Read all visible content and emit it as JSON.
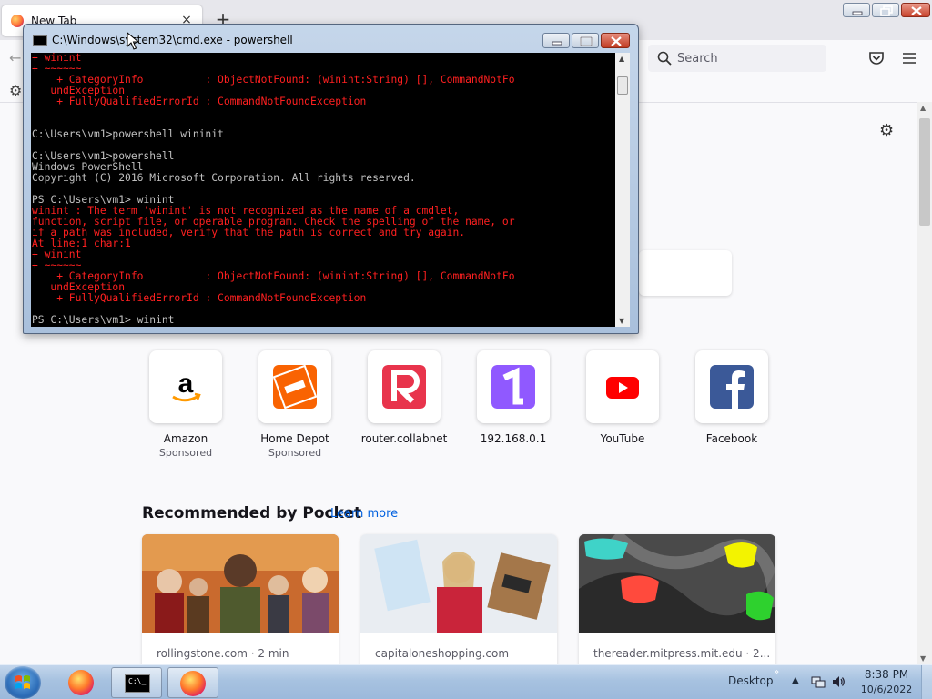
{
  "firefox": {
    "tab_title": "New Tab",
    "tab_close": "×",
    "new_tab": "+",
    "search_placeholder": "Search",
    "top_sites": [
      {
        "name": "Amazon",
        "sub": "Sponsored",
        "icon": "amazon-logo"
      },
      {
        "name": "Home Depot",
        "sub": "Sponsored",
        "icon": "home-depot-logo"
      },
      {
        "name": "router.collabnet",
        "sub": "",
        "icon": "router-logo"
      },
      {
        "name": "192.168.0.1",
        "sub": "",
        "icon": "number-one-logo"
      },
      {
        "name": "YouTube",
        "sub": "",
        "icon": "youtube-logo"
      },
      {
        "name": "Facebook",
        "sub": "",
        "icon": "facebook-logo"
      }
    ],
    "pocket": {
      "title": "Recommended by Pocket",
      "learn_more": "Learn more",
      "stories": [
        {
          "source": "rollingstone.com · 2 min"
        },
        {
          "source": "capitaloneshopping.com"
        },
        {
          "source": "thereader.mitpress.mit.edu · 2..."
        }
      ]
    }
  },
  "cmd": {
    "title": "C:\\Windows\\system32\\cmd.exe - powershell",
    "lines": [
      {
        "t": "+ winint",
        "err": true
      },
      {
        "t": "+ ~~~~~~",
        "err": true
      },
      {
        "t": "    + CategoryInfo          : ObjectNotFound: (winint:String) [], CommandNotFo",
        "err": true
      },
      {
        "t": "   undException",
        "err": true
      },
      {
        "t": "    + FullyQualifiedErrorId : CommandNotFoundException",
        "err": true
      },
      {
        "t": "",
        "err": false
      },
      {
        "t": "",
        "err": false
      },
      {
        "t": "C:\\Users\\vm1>powershell wininit",
        "err": false
      },
      {
        "t": "",
        "err": false
      },
      {
        "t": "C:\\Users\\vm1>powershell",
        "err": false
      },
      {
        "t": "Windows PowerShell",
        "err": false
      },
      {
        "t": "Copyright (C) 2016 Microsoft Corporation. All rights reserved.",
        "err": false
      },
      {
        "t": "",
        "err": false
      },
      {
        "t": "PS C:\\Users\\vm1> winint",
        "err": false
      },
      {
        "t": "winint : The term 'winint' is not recognized as the name of a cmdlet,",
        "err": true
      },
      {
        "t": "function, script file, or operable program. Check the spelling of the name, or",
        "err": true
      },
      {
        "t": "if a path was included, verify that the path is correct and try again.",
        "err": true
      },
      {
        "t": "At line:1 char:1",
        "err": true
      },
      {
        "t": "+ winint",
        "err": true
      },
      {
        "t": "+ ~~~~~~",
        "err": true
      },
      {
        "t": "    + CategoryInfo          : ObjectNotFound: (winint:String) [], CommandNotFo",
        "err": true
      },
      {
        "t": "   undException",
        "err": true
      },
      {
        "t": "    + FullyQualifiedErrorId : CommandNotFoundException",
        "err": true
      },
      {
        "t": "",
        "err": false
      },
      {
        "t": "PS C:\\Users\\vm1> winint",
        "err": false
      }
    ]
  },
  "taskbar": {
    "desktop_label": "Desktop",
    "time": "8:38 PM",
    "date": "10/6/2022"
  },
  "colors": {
    "console_error": "#ff2020",
    "console_text": "#c0c0c0",
    "link": "#0060df"
  }
}
